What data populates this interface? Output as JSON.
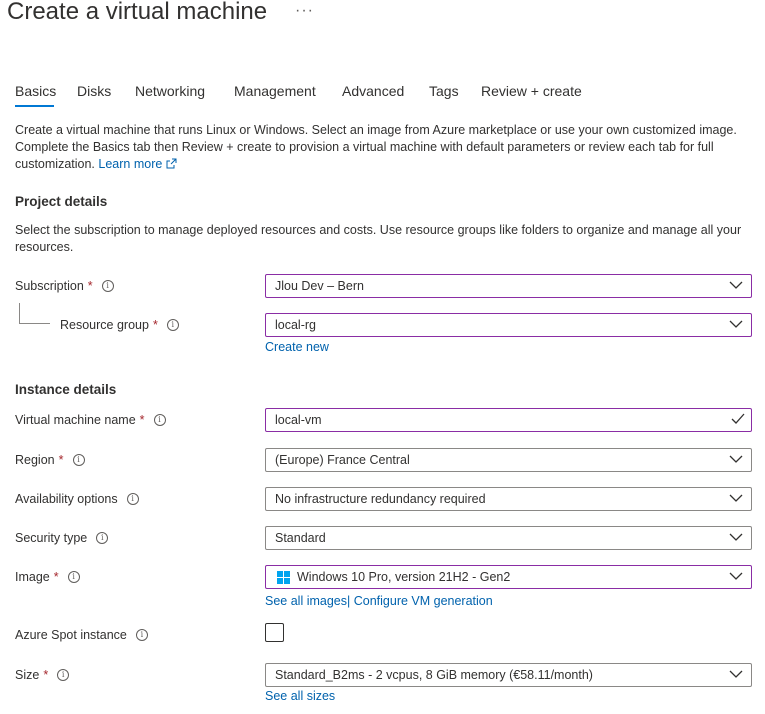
{
  "page": {
    "title": "Create a virtual machine",
    "more": "···"
  },
  "tabs": [
    "Basics",
    "Disks",
    "Networking",
    "Management",
    "Advanced",
    "Tags",
    "Review + create"
  ],
  "intro": {
    "text": "Create a virtual machine that runs Linux or Windows. Select an image from Azure marketplace or use your own customized image. Complete the Basics tab then Review + create to provision a virtual machine with default parameters or review each tab for full customization.",
    "learn_more": "Learn more"
  },
  "project": {
    "heading": "Project details",
    "description": "Select the subscription to manage deployed resources and costs. Use resource groups like folders to organize and manage all your resources.",
    "subscription_label": "Subscription",
    "subscription_value": "Jlou Dev – Bern",
    "resource_group_label": "Resource group",
    "resource_group_value": "local-rg",
    "create_new": "Create new"
  },
  "instance": {
    "heading": "Instance details",
    "vm_name_label": "Virtual machine name",
    "vm_name_value": "local-vm",
    "region_label": "Region",
    "region_value": "(Europe) France Central",
    "availability_label": "Availability options",
    "availability_value": "No infrastructure redundancy required",
    "security_label": "Security type",
    "security_value": "Standard",
    "image_label": "Image",
    "image_value": "Windows 10 Pro, version 21H2 - Gen2",
    "see_all_images": "See all images",
    "configure_vm": "Configure VM generation",
    "spot_label": "Azure Spot instance",
    "size_label": "Size",
    "size_value": "Standard_B2ms - 2 vcpus, 8 GiB memory (€58.11/month)",
    "see_all_sizes": "See all sizes"
  },
  "required_mark": "*",
  "info_glyph": "i",
  "colors": {
    "accent": "#0078d4",
    "focus_border": "#8a2da5",
    "link": "#0062ad",
    "required": "#a4262c"
  }
}
